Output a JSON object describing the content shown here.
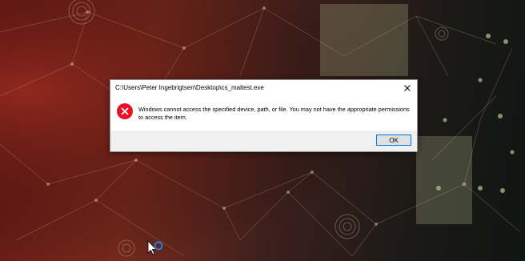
{
  "desktop": {
    "wallpaper": "network-globe-wallpaper"
  },
  "dialog": {
    "title": "C:\\Users\\Peter Ingebrigtsen\\Desktop\\cs_maltest.exe",
    "close_icon": "close-icon",
    "error_icon": "error-icon",
    "message": "Windows cannot access the specified device, path, or file. You may not have the appropriate permissions to access the item.",
    "ok_label": "OK",
    "accent_color": "#0078d7",
    "error_color": "#e81123"
  },
  "cursor": {
    "type": "busy-cursor"
  }
}
